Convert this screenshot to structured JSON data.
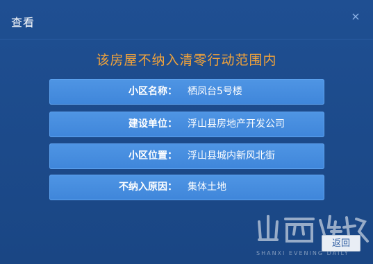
{
  "dialog": {
    "title": "查看",
    "close_glyph": "×"
  },
  "heading": "该房屋不纳入清零行动范围内",
  "rows": [
    {
      "label": "小区名称",
      "colon": "：",
      "value": "栖凤台5号楼"
    },
    {
      "label": "建设单位",
      "colon": "：",
      "value": "浮山县房地产开发公司"
    },
    {
      "label": "小区位置",
      "colon": "：",
      "value": "浮山县城内新风北街"
    },
    {
      "label": "不纳入原因",
      "colon": "：",
      "value": "集体土地"
    }
  ],
  "footer": {
    "back_label": "返回"
  },
  "watermark": {
    "text": "山西晚报",
    "subtext": "SHANXI EVENING DAILY"
  },
  "colors": {
    "background": "#1d4d8f",
    "row": "#4a8fe0",
    "heading": "#f2a33a"
  }
}
